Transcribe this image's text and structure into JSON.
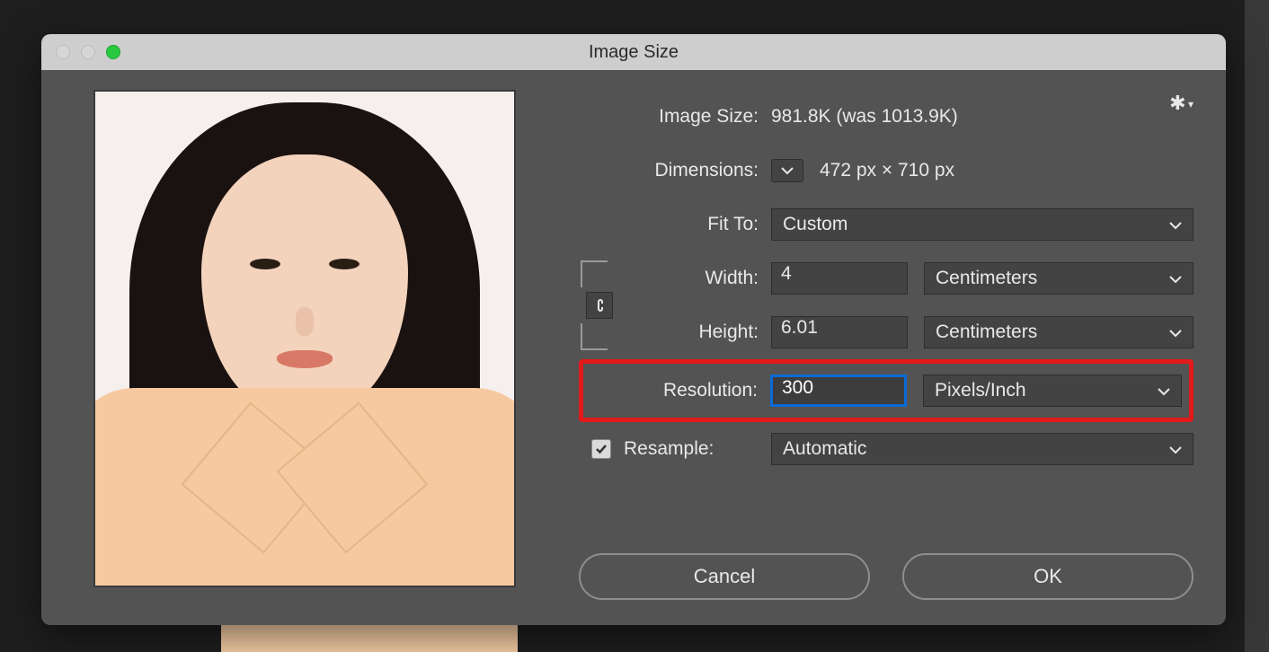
{
  "dialog": {
    "title": "Image Size",
    "image_size_label": "Image Size:",
    "image_size_value": "981.8K (was 1013.9K)",
    "dimensions_label": "Dimensions:",
    "dimensions_value": "472 px  ×  710 px",
    "fit_to_label": "Fit To:",
    "fit_to_value": "Custom",
    "width_label": "Width:",
    "width_value": "4",
    "width_unit": "Centimeters",
    "height_label": "Height:",
    "height_value": "6.01",
    "height_unit": "Centimeters",
    "resolution_label": "Resolution:",
    "resolution_value": "300",
    "resolution_unit": "Pixels/Inch",
    "resample_label": "Resample:",
    "resample_value": "Automatic",
    "cancel": "Cancel",
    "ok": "OK"
  }
}
